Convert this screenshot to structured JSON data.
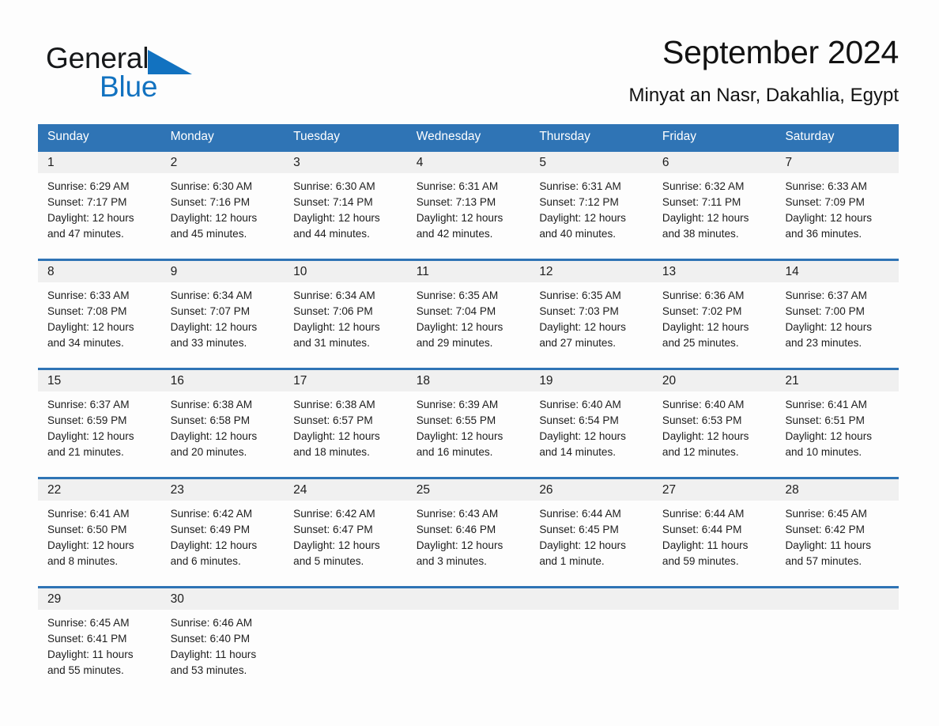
{
  "brand": {
    "name_part1": "General",
    "name_part2": "Blue",
    "triangle_color": "#1272c0"
  },
  "header": {
    "title": "September 2024",
    "subtitle": "Minyat an Nasr, Dakahlia, Egypt",
    "accent_color": "#2f74b5",
    "daynum_band_color": "#f0f0f0"
  },
  "weekdays": [
    "Sunday",
    "Monday",
    "Tuesday",
    "Wednesday",
    "Thursday",
    "Friday",
    "Saturday"
  ],
  "weeks": [
    [
      {
        "day": "1",
        "sunrise": "Sunrise: 6:29 AM",
        "sunset": "Sunset: 7:17 PM",
        "daylight1": "Daylight: 12 hours",
        "daylight2": "and 47 minutes."
      },
      {
        "day": "2",
        "sunrise": "Sunrise: 6:30 AM",
        "sunset": "Sunset: 7:16 PM",
        "daylight1": "Daylight: 12 hours",
        "daylight2": "and 45 minutes."
      },
      {
        "day": "3",
        "sunrise": "Sunrise: 6:30 AM",
        "sunset": "Sunset: 7:14 PM",
        "daylight1": "Daylight: 12 hours",
        "daylight2": "and 44 minutes."
      },
      {
        "day": "4",
        "sunrise": "Sunrise: 6:31 AM",
        "sunset": "Sunset: 7:13 PM",
        "daylight1": "Daylight: 12 hours",
        "daylight2": "and 42 minutes."
      },
      {
        "day": "5",
        "sunrise": "Sunrise: 6:31 AM",
        "sunset": "Sunset: 7:12 PM",
        "daylight1": "Daylight: 12 hours",
        "daylight2": "and 40 minutes."
      },
      {
        "day": "6",
        "sunrise": "Sunrise: 6:32 AM",
        "sunset": "Sunset: 7:11 PM",
        "daylight1": "Daylight: 12 hours",
        "daylight2": "and 38 minutes."
      },
      {
        "day": "7",
        "sunrise": "Sunrise: 6:33 AM",
        "sunset": "Sunset: 7:09 PM",
        "daylight1": "Daylight: 12 hours",
        "daylight2": "and 36 minutes."
      }
    ],
    [
      {
        "day": "8",
        "sunrise": "Sunrise: 6:33 AM",
        "sunset": "Sunset: 7:08 PM",
        "daylight1": "Daylight: 12 hours",
        "daylight2": "and 34 minutes."
      },
      {
        "day": "9",
        "sunrise": "Sunrise: 6:34 AM",
        "sunset": "Sunset: 7:07 PM",
        "daylight1": "Daylight: 12 hours",
        "daylight2": "and 33 minutes."
      },
      {
        "day": "10",
        "sunrise": "Sunrise: 6:34 AM",
        "sunset": "Sunset: 7:06 PM",
        "daylight1": "Daylight: 12 hours",
        "daylight2": "and 31 minutes."
      },
      {
        "day": "11",
        "sunrise": "Sunrise: 6:35 AM",
        "sunset": "Sunset: 7:04 PM",
        "daylight1": "Daylight: 12 hours",
        "daylight2": "and 29 minutes."
      },
      {
        "day": "12",
        "sunrise": "Sunrise: 6:35 AM",
        "sunset": "Sunset: 7:03 PM",
        "daylight1": "Daylight: 12 hours",
        "daylight2": "and 27 minutes."
      },
      {
        "day": "13",
        "sunrise": "Sunrise: 6:36 AM",
        "sunset": "Sunset: 7:02 PM",
        "daylight1": "Daylight: 12 hours",
        "daylight2": "and 25 minutes."
      },
      {
        "day": "14",
        "sunrise": "Sunrise: 6:37 AM",
        "sunset": "Sunset: 7:00 PM",
        "daylight1": "Daylight: 12 hours",
        "daylight2": "and 23 minutes."
      }
    ],
    [
      {
        "day": "15",
        "sunrise": "Sunrise: 6:37 AM",
        "sunset": "Sunset: 6:59 PM",
        "daylight1": "Daylight: 12 hours",
        "daylight2": "and 21 minutes."
      },
      {
        "day": "16",
        "sunrise": "Sunrise: 6:38 AM",
        "sunset": "Sunset: 6:58 PM",
        "daylight1": "Daylight: 12 hours",
        "daylight2": "and 20 minutes."
      },
      {
        "day": "17",
        "sunrise": "Sunrise: 6:38 AM",
        "sunset": "Sunset: 6:57 PM",
        "daylight1": "Daylight: 12 hours",
        "daylight2": "and 18 minutes."
      },
      {
        "day": "18",
        "sunrise": "Sunrise: 6:39 AM",
        "sunset": "Sunset: 6:55 PM",
        "daylight1": "Daylight: 12 hours",
        "daylight2": "and 16 minutes."
      },
      {
        "day": "19",
        "sunrise": "Sunrise: 6:40 AM",
        "sunset": "Sunset: 6:54 PM",
        "daylight1": "Daylight: 12 hours",
        "daylight2": "and 14 minutes."
      },
      {
        "day": "20",
        "sunrise": "Sunrise: 6:40 AM",
        "sunset": "Sunset: 6:53 PM",
        "daylight1": "Daylight: 12 hours",
        "daylight2": "and 12 minutes."
      },
      {
        "day": "21",
        "sunrise": "Sunrise: 6:41 AM",
        "sunset": "Sunset: 6:51 PM",
        "daylight1": "Daylight: 12 hours",
        "daylight2": "and 10 minutes."
      }
    ],
    [
      {
        "day": "22",
        "sunrise": "Sunrise: 6:41 AM",
        "sunset": "Sunset: 6:50 PM",
        "daylight1": "Daylight: 12 hours",
        "daylight2": "and 8 minutes."
      },
      {
        "day": "23",
        "sunrise": "Sunrise: 6:42 AM",
        "sunset": "Sunset: 6:49 PM",
        "daylight1": "Daylight: 12 hours",
        "daylight2": "and 6 minutes."
      },
      {
        "day": "24",
        "sunrise": "Sunrise: 6:42 AM",
        "sunset": "Sunset: 6:47 PM",
        "daylight1": "Daylight: 12 hours",
        "daylight2": "and 5 minutes."
      },
      {
        "day": "25",
        "sunrise": "Sunrise: 6:43 AM",
        "sunset": "Sunset: 6:46 PM",
        "daylight1": "Daylight: 12 hours",
        "daylight2": "and 3 minutes."
      },
      {
        "day": "26",
        "sunrise": "Sunrise: 6:44 AM",
        "sunset": "Sunset: 6:45 PM",
        "daylight1": "Daylight: 12 hours",
        "daylight2": "and 1 minute."
      },
      {
        "day": "27",
        "sunrise": "Sunrise: 6:44 AM",
        "sunset": "Sunset: 6:44 PM",
        "daylight1": "Daylight: 11 hours",
        "daylight2": "and 59 minutes."
      },
      {
        "day": "28",
        "sunrise": "Sunrise: 6:45 AM",
        "sunset": "Sunset: 6:42 PM",
        "daylight1": "Daylight: 11 hours",
        "daylight2": "and 57 minutes."
      }
    ],
    [
      {
        "day": "29",
        "sunrise": "Sunrise: 6:45 AM",
        "sunset": "Sunset: 6:41 PM",
        "daylight1": "Daylight: 11 hours",
        "daylight2": "and 55 minutes."
      },
      {
        "day": "30",
        "sunrise": "Sunrise: 6:46 AM",
        "sunset": "Sunset: 6:40 PM",
        "daylight1": "Daylight: 11 hours",
        "daylight2": "and 53 minutes."
      },
      {
        "day": "",
        "sunrise": "",
        "sunset": "",
        "daylight1": "",
        "daylight2": ""
      },
      {
        "day": "",
        "sunrise": "",
        "sunset": "",
        "daylight1": "",
        "daylight2": ""
      },
      {
        "day": "",
        "sunrise": "",
        "sunset": "",
        "daylight1": "",
        "daylight2": ""
      },
      {
        "day": "",
        "sunrise": "",
        "sunset": "",
        "daylight1": "",
        "daylight2": ""
      },
      {
        "day": "",
        "sunrise": "",
        "sunset": "",
        "daylight1": "",
        "daylight2": ""
      }
    ]
  ]
}
